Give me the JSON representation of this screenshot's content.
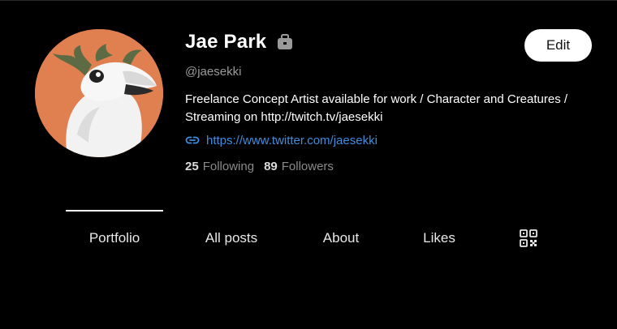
{
  "profile": {
    "name": "Jae Park",
    "handle": "@jaesekki",
    "bio": "Freelance Concept Artist available for work / Character and Creatures / Streaming on http://twitch.tv/jaesekki",
    "link": "https://www.twitter.com/jaesekki",
    "badge_icon": "briefcase-icon",
    "link_icon": "link-icon"
  },
  "stats": {
    "following_count": "25",
    "following_label": "Following",
    "followers_count": "89",
    "followers_label": "Followers"
  },
  "actions": {
    "edit_label": "Edit"
  },
  "tabs": [
    {
      "label": "Portfolio",
      "active": true
    },
    {
      "label": "All posts",
      "active": false
    },
    {
      "label": "About",
      "active": false
    },
    {
      "label": "Likes",
      "active": false
    },
    {
      "icon": "qr-code-icon",
      "active": false
    }
  ],
  "colors": {
    "background": "#000000",
    "avatar_bg": "#e07f4f",
    "link": "#3e8de0",
    "muted": "#9a9a9a"
  }
}
